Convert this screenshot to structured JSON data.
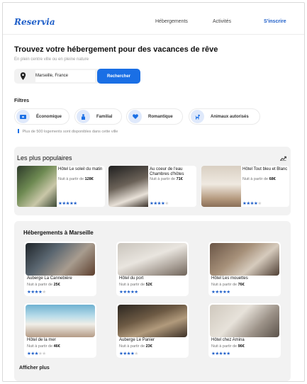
{
  "brand": {
    "logo": "Reservia"
  },
  "nav": {
    "item1": "Hébergements",
    "item2": "Activités",
    "signup": "S'inscrire"
  },
  "hero": {
    "title": "Trouvez votre hébergement pour des vacances de rêve",
    "subtitle": "En plein centre ville ou en pleine nature",
    "search_value": "Marseille, France",
    "search_button": "Rechercher",
    "search_icon": "location-pin-icon"
  },
  "filters": {
    "title": "Filtres",
    "items": [
      {
        "label": "Économique",
        "icon": "money-icon"
      },
      {
        "label": "Familial",
        "icon": "family-icon"
      },
      {
        "label": "Romantique",
        "icon": "heart-icon"
      },
      {
        "label": "Animaux autorisés",
        "icon": "dog-icon"
      }
    ],
    "info": "Plus de 500 logements sont disponibles dans cette ville"
  },
  "popular": {
    "title": "Les plus populaires",
    "icon": "trending-icon",
    "cards": [
      {
        "name": "Hôtel Le soleil du matin",
        "price_prefix": "Nuit à partir de ",
        "price": "128€",
        "rating": 5
      },
      {
        "name": "Au coeur de l'eau Chambres d'hôtes",
        "price_prefix": "Nuit à partir de ",
        "price": "71€",
        "rating": 4
      },
      {
        "name": "Hôtel Tout bleu et Blanc",
        "price_prefix": "Nuit à partir de ",
        "price": "68€",
        "rating": 4
      }
    ]
  },
  "marseille": {
    "title": "Hébergements à Marseille",
    "more": "Afficher plus",
    "cards": [
      {
        "name": "Auberge La Cannebière",
        "price_prefix": "Nuit à partir de ",
        "price": "25€",
        "rating": 4
      },
      {
        "name": "Hôtel du port",
        "price_prefix": "Nuit à partir de ",
        "price": "52€",
        "rating": 5
      },
      {
        "name": "Hôtel Les mouettes",
        "price_prefix": "Nuit à partir de ",
        "price": "76€",
        "rating": 5
      },
      {
        "name": "Hôtel de la mer",
        "price_prefix": "Nuit à partir de ",
        "price": "46€",
        "rating": 3
      },
      {
        "name": "Auberge Le Panier",
        "price_prefix": "Nuit à partir de ",
        "price": "23€",
        "rating": 4
      },
      {
        "name": "Hôtel chez Amina",
        "price_prefix": "Nuit à partir de ",
        "price": "96€",
        "rating": 5
      }
    ]
  },
  "colors": {
    "accent": "#1a6fe5",
    "brand": "#1f5fc9",
    "panel": "#f2f2f2",
    "chip_icon_bg": "#dfe9fb"
  }
}
